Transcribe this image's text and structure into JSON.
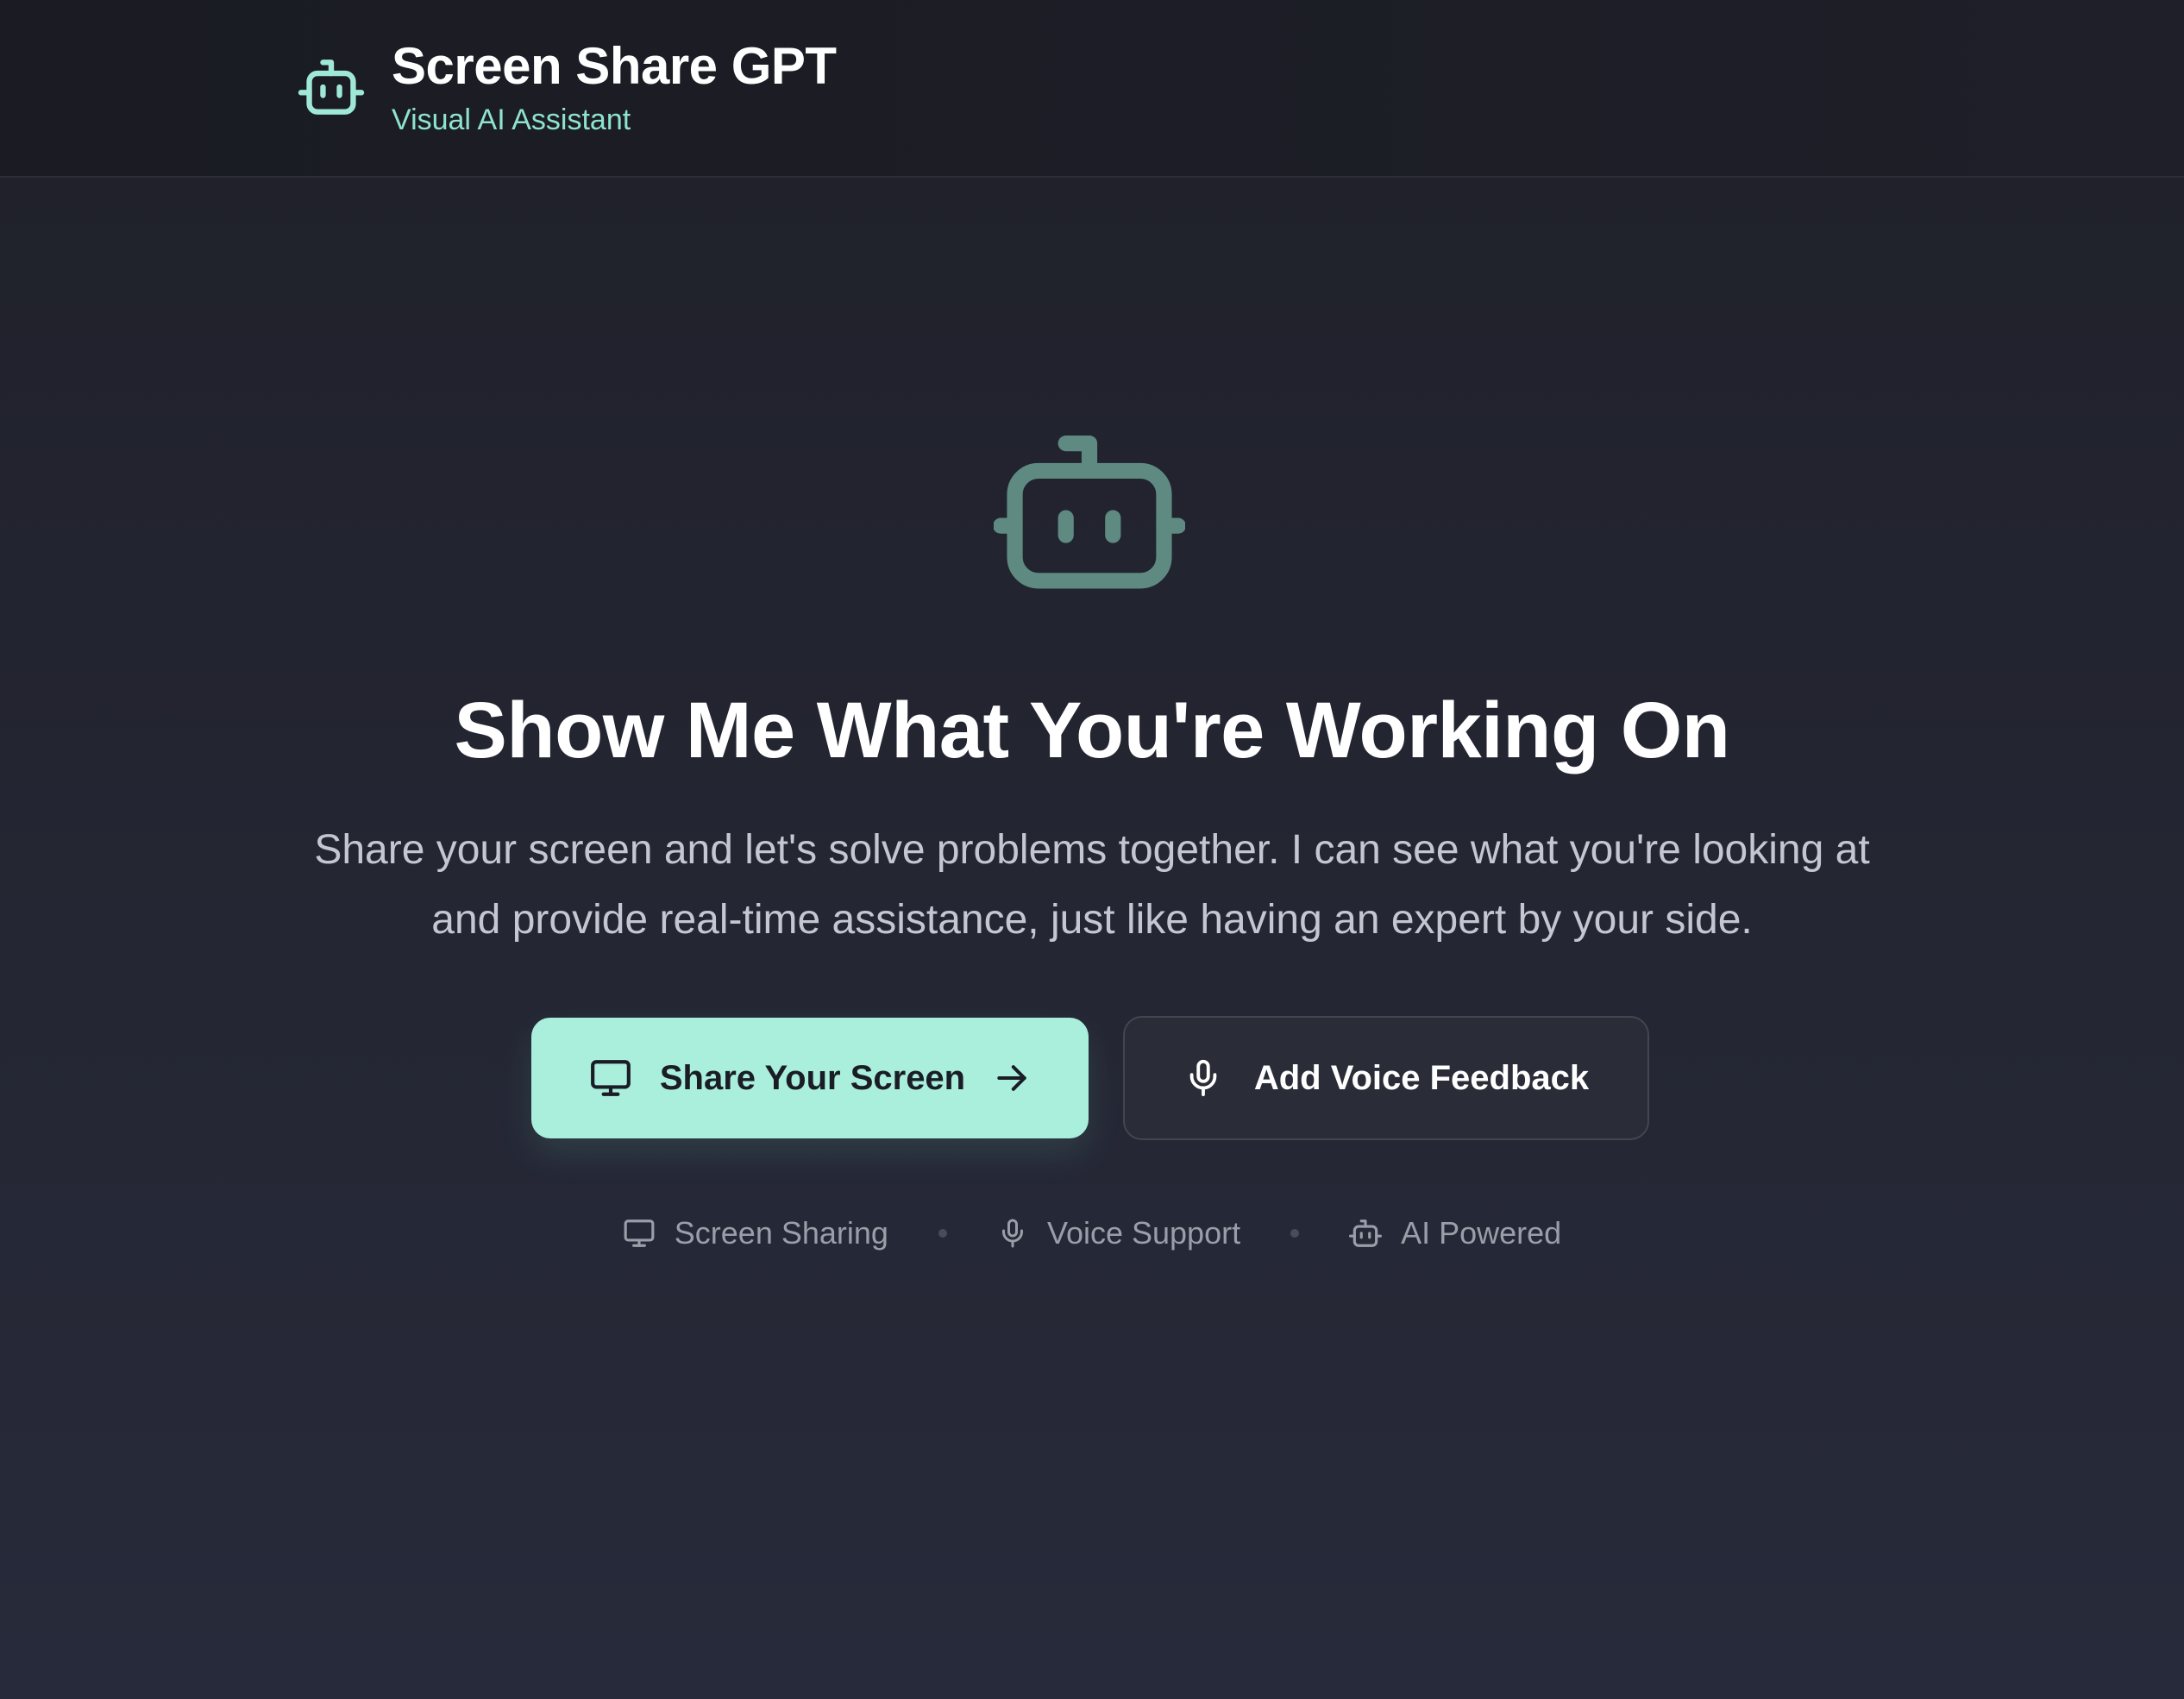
{
  "header": {
    "logo_icon": "robot-icon",
    "title": "Screen Share GPT",
    "subtitle": "Visual AI Assistant"
  },
  "hero": {
    "icon": "robot-icon",
    "headline": "Show Me What You're Working On",
    "description": "Share your screen and let's solve problems together. I can see what you're looking at and provide real-time assistance, just like having an expert by your side."
  },
  "actions": {
    "primary": {
      "label": "Share Your Screen",
      "icon": "monitor-icon",
      "trailing_icon": "arrow-right-icon"
    },
    "secondary": {
      "label": "Add Voice Feedback",
      "icon": "microphone-icon"
    }
  },
  "features": [
    {
      "label": "Screen Sharing",
      "icon": "monitor-icon"
    },
    {
      "label": "Voice Support",
      "icon": "microphone-icon"
    },
    {
      "label": "AI Powered",
      "icon": "robot-icon"
    }
  ],
  "colors": {
    "accent": "#a9efdc",
    "accent_text": "#8ee3cf",
    "background": "#23252f",
    "hero_icon": "#5e8a82"
  }
}
